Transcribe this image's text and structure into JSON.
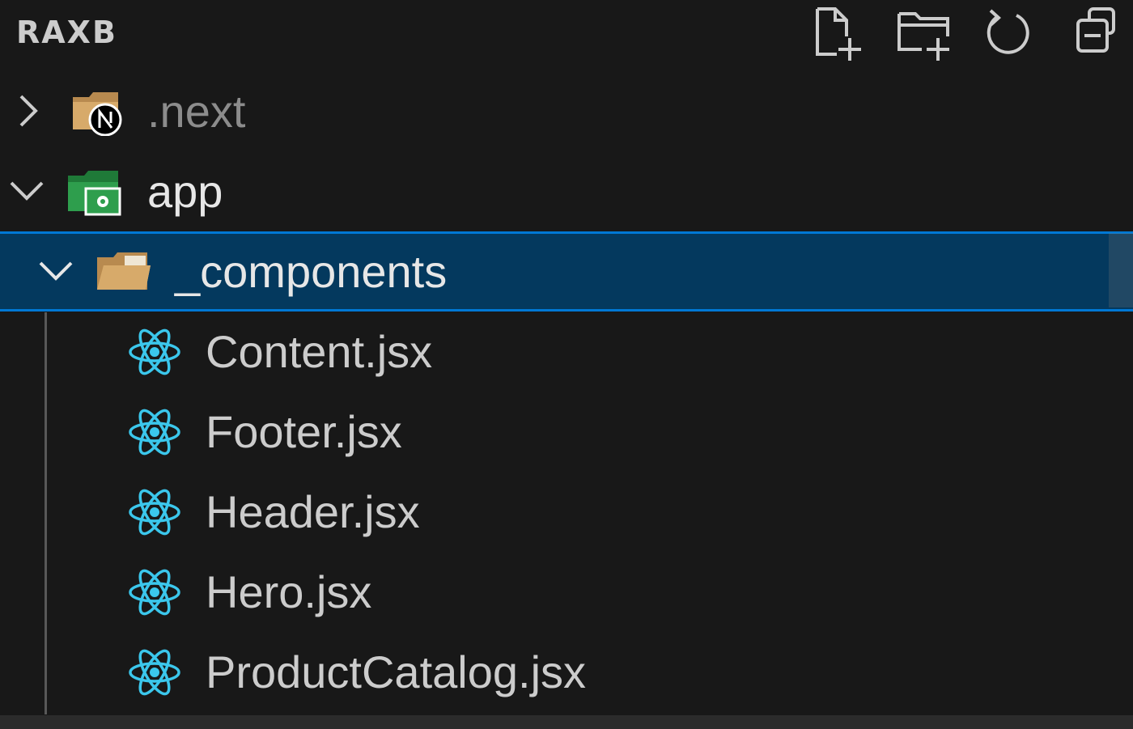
{
  "explorer": {
    "title": "RAXB",
    "toolbar": {
      "new_file_icon": "new-file-icon",
      "new_folder_icon": "new-folder-icon",
      "refresh_icon": "refresh-icon",
      "collapse_all_icon": "collapse-all-icon"
    }
  },
  "tree": {
    "next_folder": {
      "label": ".next",
      "expanded": false,
      "icon": "nextjs-folder-icon"
    },
    "app_folder": {
      "label": "app",
      "expanded": true,
      "icon": "app-folder-icon"
    },
    "components_folder": {
      "label": "_components",
      "expanded": true,
      "selected": true,
      "icon": "folder-open-icon"
    },
    "files": [
      {
        "label": "Content.jsx",
        "icon": "react-icon"
      },
      {
        "label": "Footer.jsx",
        "icon": "react-icon"
      },
      {
        "label": "Header.jsx",
        "icon": "react-icon"
      },
      {
        "label": "Hero.jsx",
        "icon": "react-icon"
      },
      {
        "label": "ProductCatalog.jsx",
        "icon": "react-icon"
      }
    ]
  },
  "colors": {
    "background": "#181818",
    "selection_bg": "#04395e",
    "selection_border": "#0078d4",
    "react_cyan": "#3bc7ec",
    "folder_tan": "#d7aa6a",
    "app_folder_green": "#2e9e4d"
  }
}
